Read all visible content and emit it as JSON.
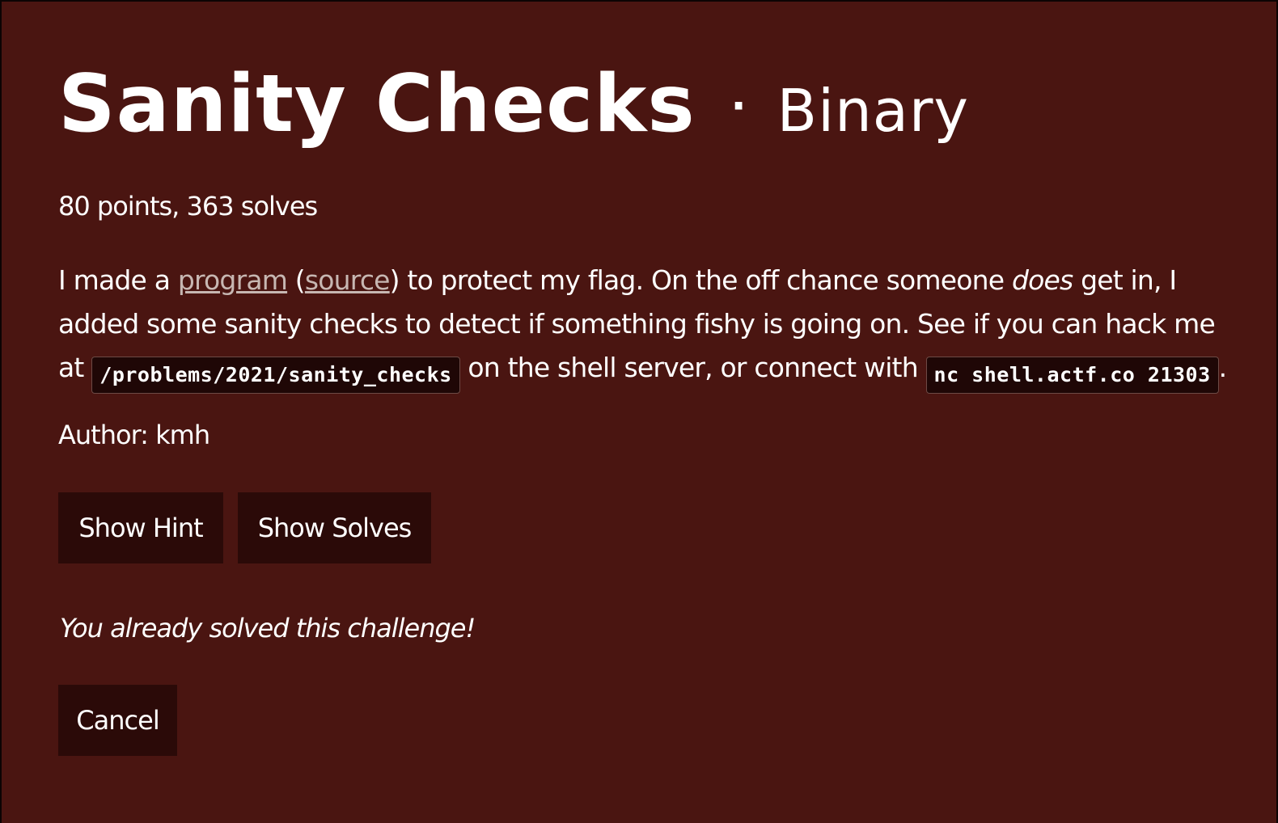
{
  "challenge": {
    "title": "Sanity Checks",
    "separator": "·",
    "category": "Binary",
    "stats": "80 points, 363 solves",
    "description": {
      "part1": "I made a ",
      "program_link": "program",
      "paren_open": " (",
      "source_link": "source",
      "part2": ") to protect my flag. On the off chance someone ",
      "emphasis": "does",
      "part3": " get in, I added some sanity checks to detect if something fishy is going on. See if you can hack me at ",
      "path_code": "/problems/2021/sanity_checks",
      "part4": " on the shell server, or connect with ",
      "nc_code": "nc shell.actf.co 21303",
      "part5": "."
    },
    "author": "Author: kmh",
    "solved_message": "You already solved this challenge!"
  },
  "buttons": {
    "show_hint": "Show Hint",
    "show_solves": "Show Solves",
    "cancel": "Cancel"
  },
  "colors": {
    "modal_bg": "#4a1511",
    "button_bg": "#2b0a08",
    "code_bg": "#1f0706",
    "link": "#c7b7b2",
    "text": "#ffffff"
  }
}
